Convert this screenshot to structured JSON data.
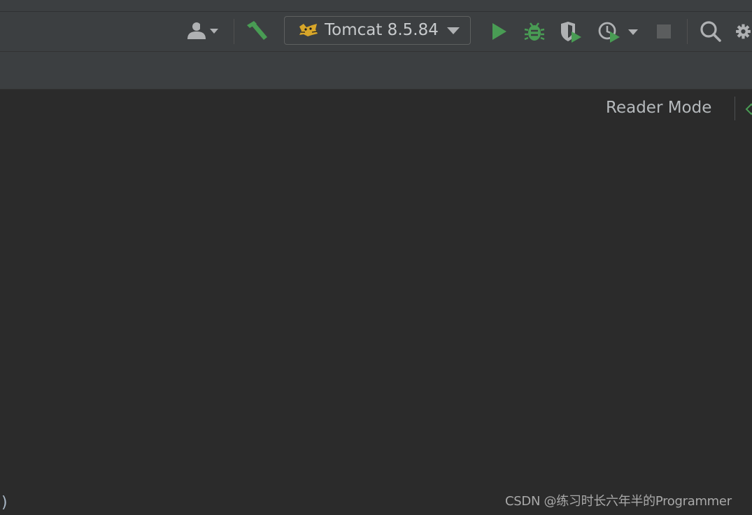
{
  "toolbar": {
    "run_config": {
      "label": "Tomcat 8.5.84",
      "icon": "tomcat-icon"
    },
    "icons": {
      "account": "user-icon",
      "build": "hammer-icon",
      "run": "run-icon",
      "debug": "bug-icon",
      "coverage": "coverage-shield-icon",
      "profiler": "profiler-clock-icon",
      "stop": "stop-icon",
      "search": "search-icon",
      "settings": "gear-icon"
    },
    "colors": {
      "run_green": "#499c54",
      "icon_gray": "#afb1b3",
      "stop_gray": "#5b5d5e"
    }
  },
  "editor": {
    "reader_mode": "Reader Mode",
    "gutter_char": ")"
  },
  "watermark": {
    "text": "CSDN @练习时长六年半的Programmer"
  }
}
